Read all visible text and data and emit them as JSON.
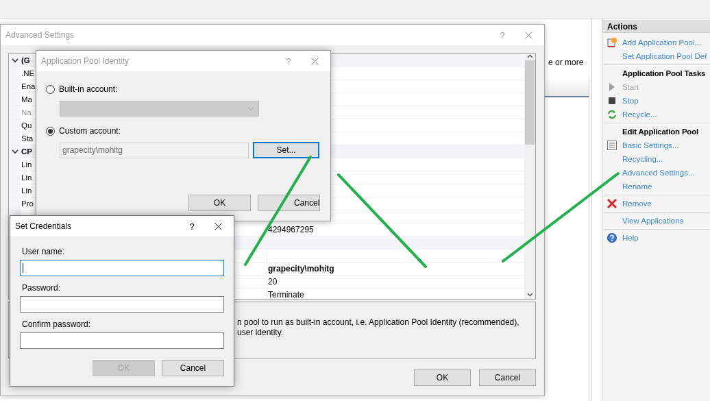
{
  "background": {
    "text": "e or more"
  },
  "actions_pane": {
    "title": "Actions",
    "items": [
      {
        "kind": "link",
        "label": "Add Application Pool...",
        "disabled": false
      },
      {
        "kind": "link",
        "label": "Set Application Pool Def",
        "disabled": false
      },
      {
        "kind": "separator"
      },
      {
        "kind": "heading",
        "label": "Application Pool Tasks"
      },
      {
        "kind": "link",
        "label": "Start",
        "disabled": true
      },
      {
        "kind": "link",
        "label": "Stop",
        "disabled": false
      },
      {
        "kind": "link",
        "label": "Recycle...",
        "disabled": false
      },
      {
        "kind": "separator"
      },
      {
        "kind": "heading",
        "label": "Edit Application Pool"
      },
      {
        "kind": "link",
        "label": "Basic Settings...",
        "disabled": false
      },
      {
        "kind": "link",
        "label": "Recycling...",
        "disabled": false
      },
      {
        "kind": "link",
        "label": "Advanced Settings...",
        "disabled": false
      },
      {
        "kind": "link",
        "label": "Rename",
        "disabled": false
      },
      {
        "kind": "separator"
      },
      {
        "kind": "link",
        "label": "Remove",
        "disabled": false
      },
      {
        "kind": "separator"
      },
      {
        "kind": "link",
        "label": "View Applications",
        "disabled": false
      },
      {
        "kind": "separator"
      },
      {
        "kind": "link",
        "label": "Help",
        "disabled": false
      }
    ]
  },
  "advanced_settings": {
    "title": "Advanced Settings",
    "help": "?",
    "active": false,
    "grid": {
      "rows": [
        {
          "kind": "group",
          "label": "(G",
          "expanded": true
        },
        {
          "kind": "property",
          "label": ".NE",
          "disabled": false
        },
        {
          "kind": "property",
          "label": "Ena",
          "disabled": false
        },
        {
          "kind": "property",
          "label": "Ma",
          "disabled": false
        },
        {
          "kind": "property",
          "label": "Na",
          "disabled": true
        },
        {
          "kind": "property",
          "label": "Qu",
          "disabled": false
        },
        {
          "kind": "property",
          "label": "Sta",
          "disabled": false
        },
        {
          "kind": "group",
          "label": "CP",
          "expanded": true
        },
        {
          "kind": "property",
          "label": "Lin",
          "disabled": false
        },
        {
          "kind": "property",
          "label": "Lin",
          "disabled": false
        },
        {
          "kind": "property",
          "label": "Lin",
          "disabled": false
        },
        {
          "kind": "property",
          "label": "Pro",
          "disabled": false
        },
        {
          "kind": "property"
        },
        {
          "kind": "property",
          "value": "4294967295",
          "modified": false
        },
        {
          "kind": "group"
        },
        {
          "kind": "property"
        },
        {
          "kind": "property",
          "value": "grapecity\\mohitg",
          "modified": true
        },
        {
          "kind": "property",
          "value": "20",
          "modified": false
        },
        {
          "kind": "property",
          "value": "Terminate",
          "modified": false
        }
      ]
    },
    "description": [
      "n pool to run as built-in account, i.e. Application Pool Identity (recommended),",
      "user identity."
    ],
    "buttons": [
      {
        "label": "OK",
        "disabled": false
      },
      {
        "label": "Cancel",
        "disabled": false
      }
    ]
  },
  "identity_dialog": {
    "title": "Application Pool Identity",
    "help": "?",
    "active": false,
    "options": [
      {
        "label": "Built-in account:",
        "selected": false
      },
      {
        "label": "Custom account:",
        "selected": true
      }
    ],
    "account_value": "grapecity\\mohitg",
    "set_button": {
      "label": "Set...",
      "focused": true
    },
    "buttons": [
      {
        "label": "OK",
        "disabled": false
      },
      {
        "label": "Cancel",
        "disabled": false
      }
    ]
  },
  "credentials_dialog": {
    "title": "Set Credentials",
    "help": "?",
    "active": true,
    "fields": [
      {
        "label": "User name:",
        "focused": true
      },
      {
        "label": "Password:",
        "focused": false
      },
      {
        "label": "Confirm password:",
        "focused": false
      }
    ],
    "buttons": [
      {
        "label": "OK",
        "disabled": true
      },
      {
        "label": "Cancel",
        "disabled": false
      }
    ]
  }
}
